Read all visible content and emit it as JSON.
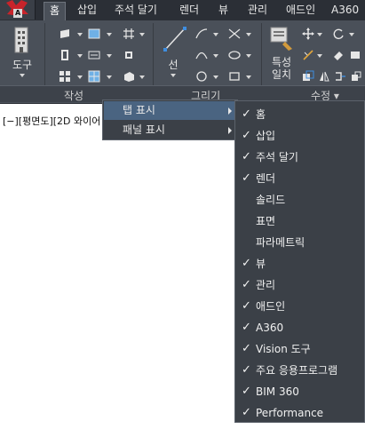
{
  "app_button": {
    "logo_text": "A"
  },
  "tabs": [
    {
      "label": "홈",
      "active": true
    },
    {
      "label": "삽입"
    },
    {
      "label": "주석 달기"
    },
    {
      "label": "렌더"
    },
    {
      "label": "뷰"
    },
    {
      "label": "관리"
    },
    {
      "label": "애드인"
    },
    {
      "label": "A360"
    }
  ],
  "ribbon": {
    "tool_button_label": "도구",
    "line_button_label": "선",
    "properties_button_label": "특성\n일치",
    "panels": [
      {
        "title": "작성"
      },
      {
        "title": "그리기"
      },
      {
        "title": "수정 ▾"
      }
    ]
  },
  "viewport": {
    "label_prefix": "[−][평면도][2D 와이어",
    "label_suffix": ""
  },
  "context_menu": {
    "items": [
      {
        "label": "탭 표시",
        "highlighted": true
      },
      {
        "label": "패널 표시",
        "highlighted": false
      }
    ]
  },
  "tab_submenu": {
    "items": [
      {
        "label": "홈",
        "checked": true
      },
      {
        "label": "삽입",
        "checked": true
      },
      {
        "label": "주석 달기",
        "checked": true
      },
      {
        "label": "렌더",
        "checked": true
      },
      {
        "label": "솔리드",
        "checked": false
      },
      {
        "label": "표면",
        "checked": false
      },
      {
        "label": "파라메트릭",
        "checked": false
      },
      {
        "label": "뷰",
        "checked": true
      },
      {
        "label": "관리",
        "checked": true
      },
      {
        "label": "애드인",
        "checked": true
      },
      {
        "label": "A360",
        "checked": true
      },
      {
        "label": "Vision 도구",
        "checked": true
      },
      {
        "label": "주요 응용프로그램",
        "checked": true
      },
      {
        "label": "BIM 360",
        "checked": true
      },
      {
        "label": "Performance",
        "checked": true
      }
    ],
    "check_glyph": "✓"
  },
  "colors": {
    "ribbon_bg": "#4a5059",
    "tabbar_bg": "#2b2f36",
    "menu_bg": "#3b4047",
    "menu_highlight": "#4a6481"
  }
}
